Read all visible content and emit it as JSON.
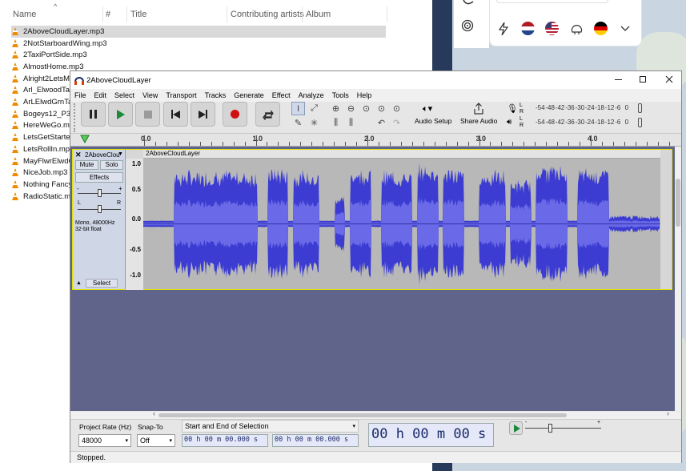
{
  "explorer": {
    "columns": [
      "Name",
      "#",
      "Title",
      "Contributing artists",
      "Album"
    ],
    "files": [
      "2AboveCloudLayer.mp3",
      "2NotStarboardWing.mp3",
      "2TaxiPortSide.mp3",
      "AlmostHome.mp3",
      "Alright2LetsMo",
      "Arl_ElwoodTake",
      "ArLElwdGrnTaxi.",
      "Bogeys12_P38s",
      "HereWeGo.mp3",
      "LetsGetStarted.r",
      "LetsRollIn.mp3",
      "MayFlwrElwdGr",
      "NiceJob.mp3",
      "Nothing Fancy.r",
      "RadioStatic.mp3"
    ],
    "selected_index": 0
  },
  "vpn": {
    "icons": [
      "lightning-icon",
      "flag-netherlands-icon",
      "flag-usa-icon",
      "server-icon",
      "flag-germany-icon",
      "chevron-down-icon"
    ]
  },
  "audacity": {
    "window_title": "2AboveCloudLayer",
    "menu": [
      "File",
      "Edit",
      "Select",
      "View",
      "Transport",
      "Tracks",
      "Generate",
      "Effect",
      "Analyze",
      "Tools",
      "Help"
    ],
    "audio_setup_label": "Audio Setup",
    "share_audio_label": "Share Audio",
    "meter_scale": [
      "-54",
      "-48",
      "-42",
      "-36",
      "-30",
      "-24",
      "-18",
      "-12",
      "-6",
      "0"
    ],
    "meter_channels": [
      "L",
      "R"
    ],
    "timeline_ticks": [
      "0.0",
      "1.0",
      "2.0",
      "3.0",
      "4.0"
    ],
    "track": {
      "name": "2AboveClou",
      "clip_name": "2AboveCloudLayer",
      "mute_label": "Mute",
      "solo_label": "Solo",
      "effects_label": "Effects",
      "info_line1": "Mono, 48000Hz",
      "info_line2": "32-bit float",
      "select_label": "Select",
      "gain_minus": "-",
      "gain_plus": "+",
      "pan_left": "L",
      "pan_right": "R",
      "y_ticks": [
        "1.0",
        "0.5",
        "0.0",
        "-0.5",
        "-1.0"
      ]
    },
    "bottom": {
      "project_rate_label": "Project Rate (Hz)",
      "project_rate_value": "48000",
      "snap_to_label": "Snap-To",
      "snap_to_value": "Off",
      "selection_mode": "Start and End of Selection",
      "sel_start": "00 h 00 m 00.000 s",
      "sel_end": "00 h 00 m 00.000 s",
      "time_display": "00 h 00 m 00 s"
    },
    "status": "Stopped.",
    "colors": {
      "waveform": "#3c3cd2",
      "waveform_light": "#6a6ae8",
      "track_bg": "#60648a",
      "record": "#d01010",
      "play": "#1a8a3a"
    }
  }
}
